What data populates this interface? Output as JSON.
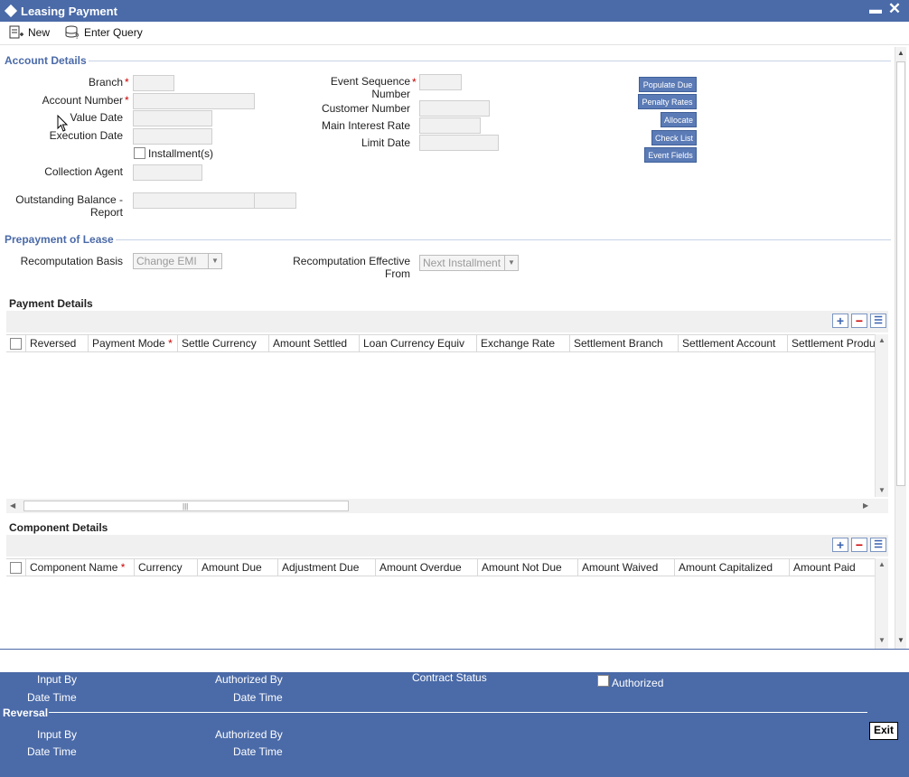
{
  "window": {
    "title": "Leasing Payment"
  },
  "toolbar": {
    "new_label": "New",
    "enter_query_label": "Enter Query"
  },
  "account_details": {
    "section_title": "Account Details",
    "branch_label": "Branch",
    "account_number_label": "Account Number",
    "value_date_label": "Value Date",
    "execution_date_label": "Execution Date",
    "installments_label": "Installment(s)",
    "collection_agent_label": "Collection Agent",
    "outstanding_balance_label_1": "Outstanding Balance -",
    "outstanding_balance_label_2": "Report",
    "event_sequence_label_1": "Event Sequence",
    "event_sequence_label_2": "Number",
    "customer_number_label": "Customer Number",
    "main_interest_rate_label": "Main Interest Rate",
    "limit_date_label": "Limit Date",
    "required_mark": "*"
  },
  "side_buttons": {
    "populate_due": "Populate Due",
    "penalty_rates": "Penalty Rates",
    "allocate": "Allocate",
    "check_list": "Check List",
    "event_fields": "Event Fields"
  },
  "prepayment": {
    "section_title": "Prepayment of Lease",
    "recomputation_basis_label": "Recomputation Basis",
    "recomputation_basis_value": "Change EMI",
    "effective_from_label_1": "Recomputation Effective",
    "effective_from_label_2": "From",
    "effective_from_value": "Next Installment"
  },
  "payment_details": {
    "title": "Payment Details",
    "columns": [
      "Reversed",
      "Payment Mode",
      "Settle Currency",
      "Amount Settled",
      "Loan Currency Equiv",
      "Exchange Rate",
      "Settlement Branch",
      "Settlement Account",
      "Settlement Produ"
    ]
  },
  "component_details": {
    "title": "Component Details",
    "columns": [
      "Component Name",
      "Currency",
      "Amount Due",
      "Adjustment Due",
      "Amount Overdue",
      "Amount Not Due",
      "Amount Waived",
      "Amount Capitalized",
      "Amount Paid"
    ]
  },
  "footer": {
    "input_by": "Input By",
    "date_time": "Date Time",
    "authorized_by": "Authorized By",
    "contract_status": "Contract Status",
    "authorized": "Authorized",
    "reversal": "Reversal",
    "exit": "Exit"
  },
  "colors": {
    "brand": "#4a6aa8",
    "button": "#5b7bb6",
    "required": "#cc0000"
  }
}
